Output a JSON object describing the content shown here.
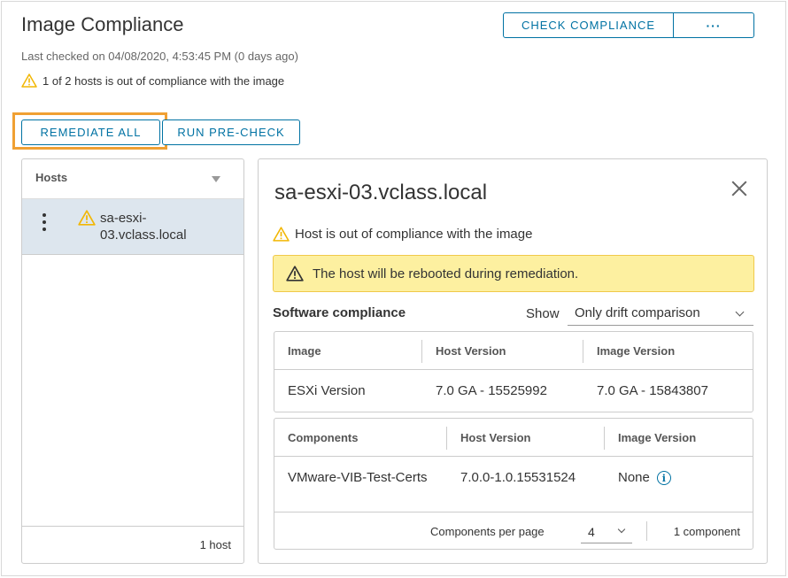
{
  "page": {
    "title": "Image Compliance",
    "last_checked": "Last checked on 04/08/2020, 4:53:45 PM (0 days ago)",
    "compliance_warning": "1 of 2 hosts is out of compliance with the image"
  },
  "toolbar": {
    "check_compliance_label": "CHECK COMPLIANCE",
    "more_label": "···",
    "remediate_all_label": "REMEDIATE ALL",
    "run_precheck_label": "RUN PRE-CHECK"
  },
  "hosts_panel": {
    "header": "Hosts",
    "items": [
      {
        "name": "sa-esxi-03.vclass.local",
        "status_icon": "warning-icon"
      }
    ],
    "footer_count": "1 host"
  },
  "detail": {
    "host_title": "sa-esxi-03.vclass.local",
    "status_text": "Host is out of compliance with the image",
    "alert_text": "The host will be rebooted during remediation.",
    "software_compliance_label": "Software compliance",
    "show_label": "Show",
    "show_selected": "Only drift comparison",
    "image_table": {
      "headers": [
        "Image",
        "Host Version",
        "Image Version"
      ],
      "rows": [
        [
          "ESXi Version",
          "7.0 GA - 15525992",
          "7.0 GA - 15843807"
        ]
      ]
    },
    "components_table": {
      "headers": [
        "Components",
        "Host Version",
        "Image Version"
      ],
      "rows": [
        [
          "VMware-VIB-Test-Certs",
          "7.0.0-1.0.15531524",
          "None"
        ]
      ],
      "per_page_label": "Components per page",
      "per_page_value": "4",
      "count_label": "1 component"
    }
  },
  "colors": {
    "accent": "#0072a3",
    "highlight": "#f0a033",
    "warning": "#f2b705",
    "alert_bg": "#fdf0a0",
    "selected_row": "#dde6ee"
  }
}
